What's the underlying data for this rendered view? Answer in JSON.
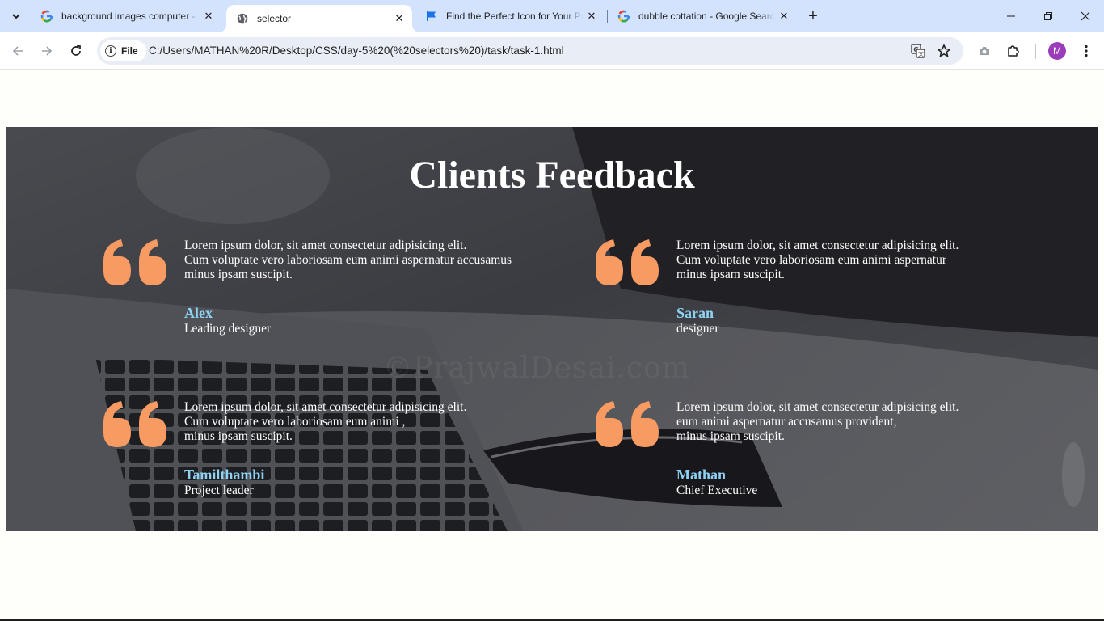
{
  "browser": {
    "tabs": [
      {
        "title": "background images computer -",
        "favicon": "google-g-icon",
        "active": false
      },
      {
        "title": "selector",
        "favicon": "globe-icon",
        "active": true
      },
      {
        "title": "Find the Perfect Icon for Your Pr",
        "favicon": "flag-icon",
        "active": false
      },
      {
        "title": "dubble cottation - Google Search",
        "favicon": "google-g-icon",
        "active": false
      }
    ],
    "close_glyph": "✕",
    "new_tab_glyph": "+",
    "address": {
      "chip_label": "File",
      "url": "C:/Users/MATHAN%20R/Desktop/CSS/day-5%20(%20selectors%20)/task/task-1.html"
    },
    "profile_initial": "M",
    "colors": {
      "tabstrip": "#d3e3fd",
      "accent_quote": "#f79b63",
      "name_color": "#8fd3f4",
      "avatar": "#9b3dba"
    }
  },
  "page": {
    "heading": "Clients Feedback",
    "watermark": "©PrajwalDesai.com",
    "testimonials": [
      {
        "lines": [
          "Lorem ipsum dolor, sit amet consectetur adipisicing elit.",
          "Cum voluptate vero laboriosam eum animi aspernatur accusamus",
          "minus ipsam suscipit."
        ],
        "name": "Alex",
        "role": "Leading designer"
      },
      {
        "lines": [
          "Lorem ipsum dolor, sit amet consectetur adipisicing elit.",
          "Cum voluptate vero laboriosam eum animi aspernatur",
          "minus ipsam suscipit."
        ],
        "name": "Saran",
        "role": "designer"
      },
      {
        "lines": [
          "Lorem ipsum dolor, sit amet consectetur adipisicing elit.",
          "Cum voluptate vero laboriosam eum animi ,",
          "minus ipsam suscipit."
        ],
        "name": "Tamilthambi",
        "role": "Project leader"
      },
      {
        "lines": [
          "Lorem ipsum dolor, sit amet consectetur adipisicing elit.",
          "eum animi aspernatur accusamus provident,",
          "minus ipsam suscipit."
        ],
        "name": "Mathan",
        "role": "Chief Executive"
      }
    ]
  }
}
